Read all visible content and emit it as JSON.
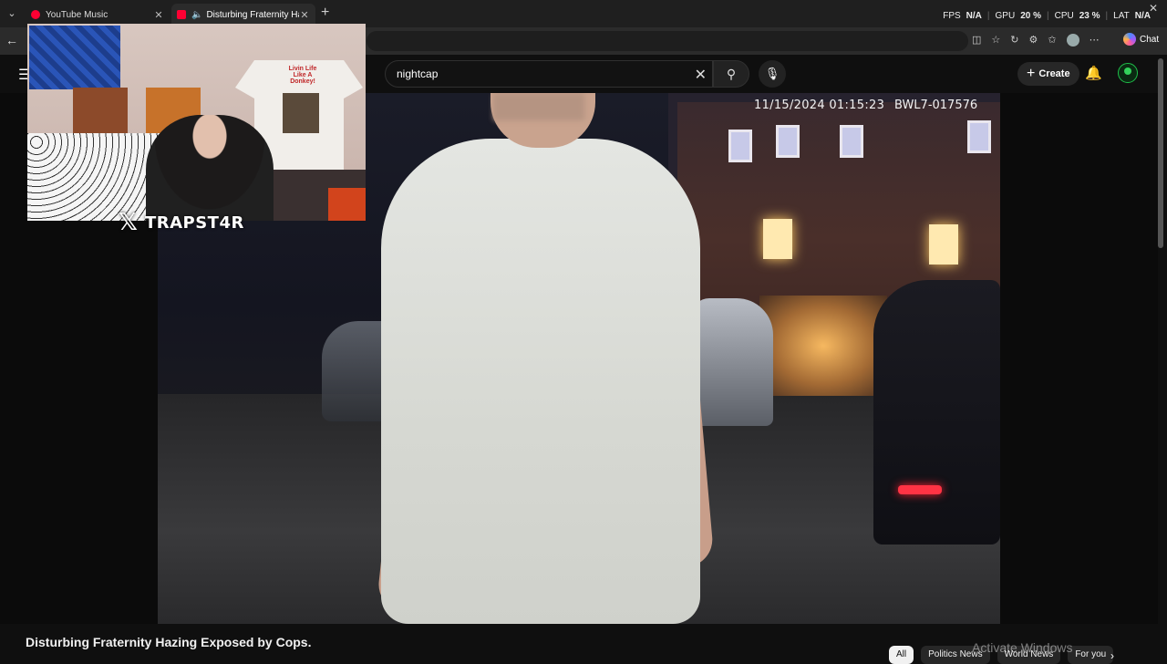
{
  "browser": {
    "tabs": [
      {
        "title": "YouTube Music",
        "active": false
      },
      {
        "title": "Disturbing Fraternity Hazing E",
        "active": true
      }
    ],
    "new_tab": "+",
    "perf": {
      "fps_label": "FPS",
      "fps_value": "N/A",
      "gpu_label": "GPU",
      "gpu_value": "20",
      "cpu_label": "CPU",
      "cpu_value": "23",
      "lat_label": "LAT",
      "lat_value": "N/A",
      "percent": "%"
    },
    "chat_label": "Chat"
  },
  "youtube": {
    "search": {
      "value": "nightcap"
    },
    "create_label": "Create"
  },
  "video": {
    "timestamp": "11/15/2024 01:15:23",
    "camera_id": "BWL7-017576",
    "title": "Disturbing Fraternity Hazing Exposed by Cops."
  },
  "webcam": {
    "social_handle": "TRAPST4R",
    "shirt_text": "Livin Life Like A Donkey!"
  },
  "chips": [
    {
      "label": "All",
      "active": true
    },
    {
      "label": "Politics News",
      "active": false
    },
    {
      "label": "World News",
      "active": false
    },
    {
      "label": "For you",
      "active": false
    }
  ],
  "watermark": "Activate Windows"
}
